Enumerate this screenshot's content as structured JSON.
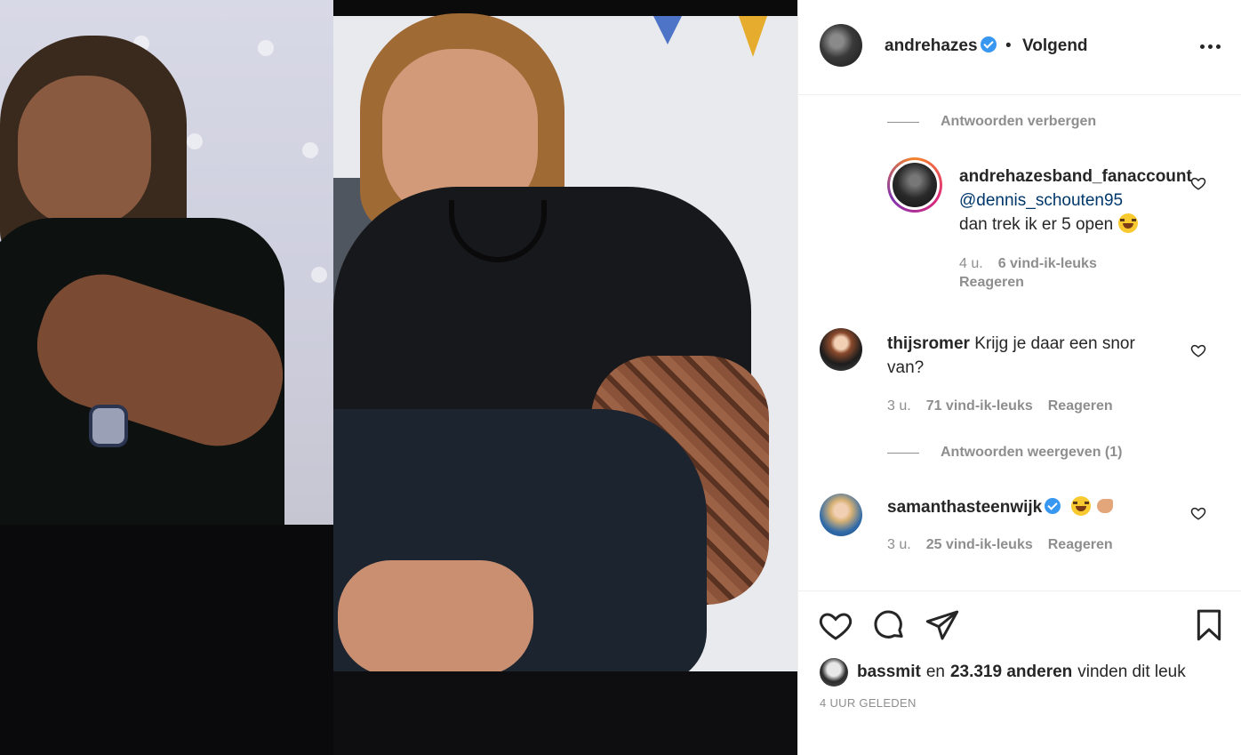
{
  "post": {
    "username": "andrehazes",
    "separator": "•",
    "follow_status": "Volgend"
  },
  "comments": {
    "hide_replies": "Antwoorden verbergen",
    "reply": {
      "username": "andrehazesband_fanaccount",
      "mention": "@dennis_schouten95",
      "text": "dan trek ik er 5 open",
      "time": "4 u.",
      "likes": "6 vind-ik-leuks",
      "reply_label": "Reageren"
    },
    "comment1": {
      "username": "thijsromer",
      "text_line1": "Krijg je daar een snor",
      "text_line2": "van?",
      "time": "3 u.",
      "likes": "71 vind-ik-leuks",
      "reply_label": "Reageren"
    },
    "show_replies": "Antwoorden weergeven (1)",
    "comment2": {
      "username": "samanthasteenwijk",
      "time": "3 u.",
      "likes": "25 vind-ik-leuks",
      "reply_label": "Reageren"
    }
  },
  "footer": {
    "liker": "bassmit",
    "and_word": "en",
    "others": "23.319 anderen",
    "suffix": "vinden dit leuk",
    "timestamp": "4 UUR GELEDEN"
  },
  "icons": {
    "verified": "verified-badge-icon",
    "more": "more-options-icon",
    "like": "heart-icon",
    "comment": "comment-bubble-icon",
    "share": "paper-plane-icon",
    "save": "bookmark-icon"
  },
  "colors": {
    "accent_blue": "#3897f0",
    "mention_blue": "#00376b",
    "secondary_text": "#8e8e8e",
    "primary_text": "#262626"
  }
}
